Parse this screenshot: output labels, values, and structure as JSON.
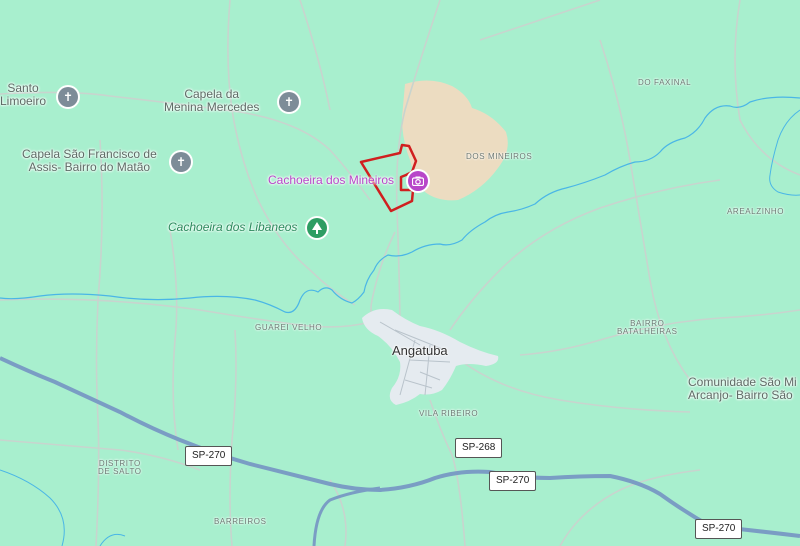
{
  "map": {
    "colors": {
      "land": "#a8efce",
      "town": "#e5ebf0",
      "quarry": "#ecdcc1",
      "river": "#4ab6e6",
      "highway": "#7a9dc4",
      "road": "#c8d4ce",
      "boundary": "#d01f1f"
    },
    "places": {
      "santo_limoeiro": [
        "Santo",
        "Limoeiro"
      ],
      "capela_menina_mercedes": [
        "Capela da",
        "Menina Mercedes"
      ],
      "capela_sao_francisco": [
        "Capela São Francisco de",
        "Assis- Bairro do Matão"
      ],
      "comunidade": [
        "Comunidade São Mi",
        "Arcanjo- Bairro São"
      ]
    },
    "areas": {
      "do_faxinal": "DO FAXINAL",
      "dos_mineiros": "DOS MINEIROS",
      "arealzinho": "AREALZINHO",
      "bairro_batalheiras": [
        "BAIRRO",
        "BATALHEIRAS"
      ],
      "guarei_velho": "GUAREI VELHO",
      "vila_ribeiro": "VILA RIBEIRO",
      "distrito_de_salto": [
        "DISTRITO",
        "DE SALTO"
      ],
      "barreiros": "BARREIROS"
    },
    "pois": {
      "cachoeira_mineiros": "Cachoeira dos Mineiros",
      "cachoeira_libaneos": "Cachoeira dos Libaneos"
    },
    "town": "Angatuba",
    "route_shields": {
      "sp270_left": "SP-270",
      "sp268": "SP-268",
      "sp270_mid": "SP-270",
      "sp270_right": "SP-270"
    },
    "icons": {
      "church": "church-icon",
      "camera": "camera-icon",
      "tree": "tree-icon"
    }
  }
}
